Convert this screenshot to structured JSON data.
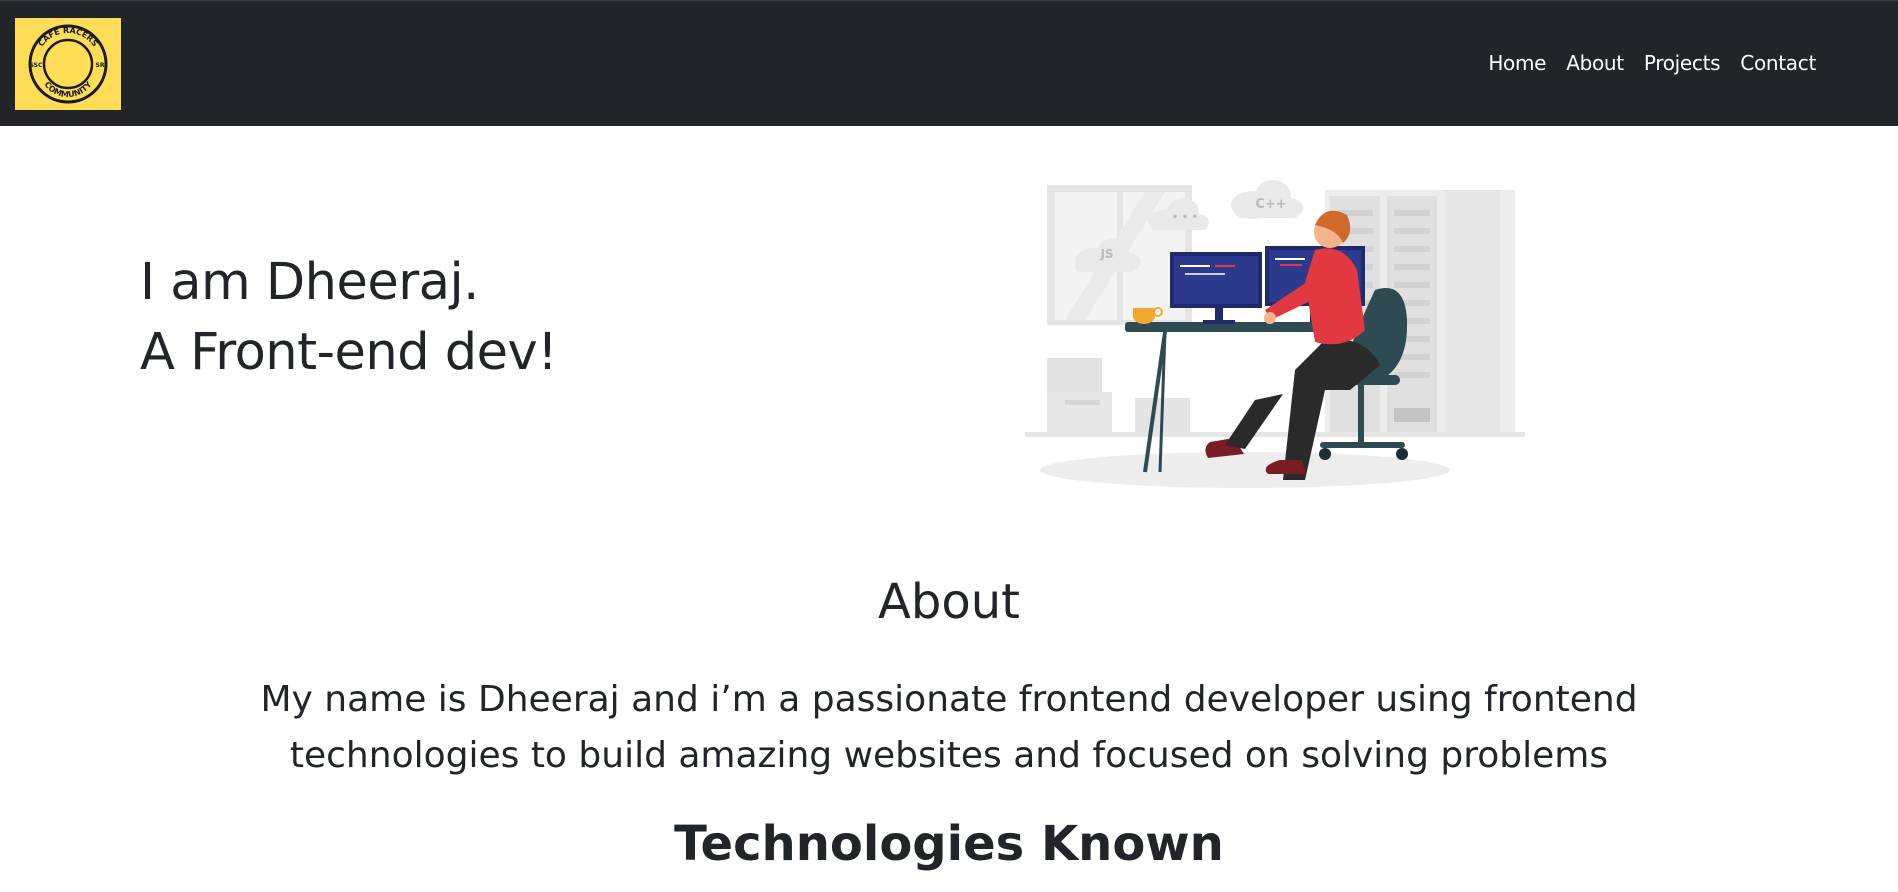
{
  "nav": {
    "logo": {
      "text_top": "CAFE RACERS",
      "text_bottom": "COMMUNITY",
      "text_left": "SSC",
      "text_right": "SR",
      "background": "#ffdd57"
    },
    "links": [
      {
        "label": "Home"
      },
      {
        "label": "About"
      },
      {
        "label": "Projects"
      },
      {
        "label": "Contact"
      }
    ]
  },
  "hero": {
    "line1": "I am Dheeraj.",
    "line2": "A Front-end dev!",
    "illustration": {
      "icon": "developer-at-desk-illustration",
      "cloud_labels": [
        "JS",
        "C++",
        "• • •"
      ]
    }
  },
  "about": {
    "title": "About",
    "text": "My name is Dheeraj and i’m a passionate frontend developer using frontend technologies to build amazing websites and focused on solving problems"
  },
  "technologies": {
    "title": "Technologies Known"
  },
  "colors": {
    "navbar": "#212529",
    "text": "#212529",
    "accent_logo": "#ffdd57",
    "shirt": "#e2383f",
    "chair": "#2e4a52"
  }
}
